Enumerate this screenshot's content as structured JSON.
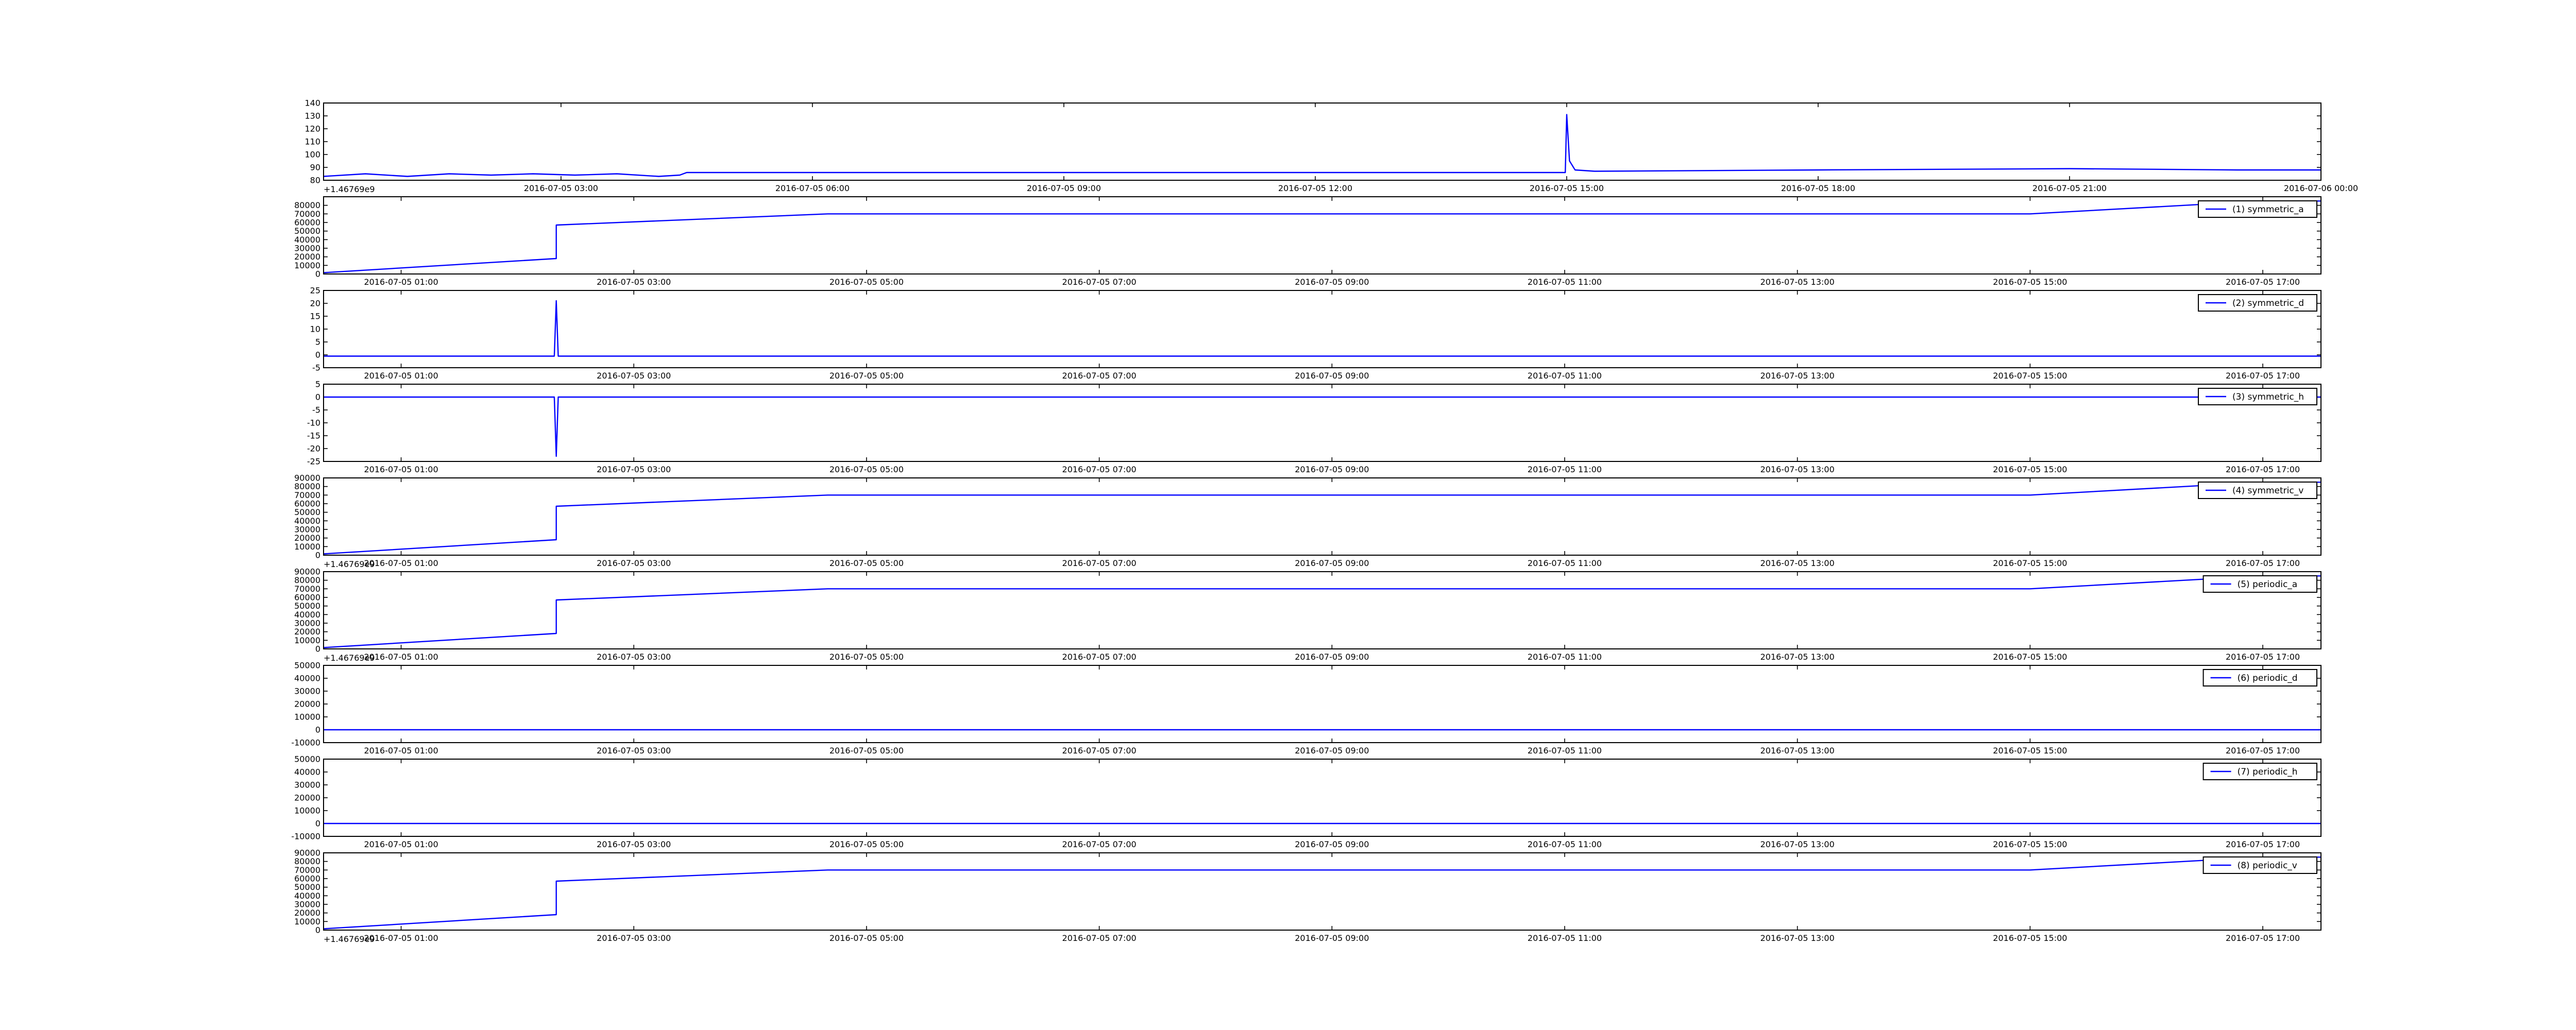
{
  "figure": {
    "line_color": "#0000ff",
    "frame_color": "#000000",
    "background": "#ffffff"
  },
  "chart_data": [
    {
      "type": "line",
      "title": "",
      "xlabel": "",
      "ylabel": "",
      "xlim": [
        "2016-07-05 00:10",
        "2016-07-06 00:00"
      ],
      "ylim": [
        80,
        140
      ],
      "yticks": [
        80,
        90,
        100,
        110,
        120,
        130,
        140
      ],
      "xticks": [
        "2016-07-05 03:00",
        "2016-07-05 06:00",
        "2016-07-05 09:00",
        "2016-07-05 12:00",
        "2016-07-05 15:00",
        "2016-07-05 18:00",
        "2016-07-05 21:00",
        "2016-07-06 00:00"
      ],
      "offset_text": "+1.46769e9",
      "legend": null,
      "grid": false,
      "series": [
        {
          "x": [
            "2016-07-05 00:10",
            "2016-07-05 00:40",
            "2016-07-05 01:10",
            "2016-07-05 01:40",
            "2016-07-05 02:10",
            "2016-07-05 02:40",
            "2016-07-05 03:10",
            "2016-07-05 03:40",
            "2016-07-05 04:10",
            "2016-07-05 04:25",
            "2016-07-05 04:30",
            "2016-07-05 09:00",
            "2016-07-05 14:30",
            "2016-07-05 14:59",
            "2016-07-05 15:00",
            "2016-07-05 15:02",
            "2016-07-05 15:06",
            "2016-07-05 15:20",
            "2016-07-05 18:00",
            "2016-07-05 21:00",
            "2016-07-05 23:00",
            "2016-07-06 00:00"
          ],
          "values": [
            83,
            85,
            83,
            85,
            84,
            85,
            84,
            85,
            83,
            84,
            86,
            86,
            86,
            86,
            131,
            95,
            88,
            87,
            88,
            89,
            88,
            88
          ]
        }
      ]
    },
    {
      "type": "line",
      "title": "",
      "xlabel": "",
      "ylabel": "",
      "xlim": [
        "2016-07-05 00:20",
        "2016-07-05 17:30"
      ],
      "ylim": [
        0,
        90000
      ],
      "yticks": [
        0,
        10000,
        20000,
        30000,
        40000,
        50000,
        60000,
        70000,
        80000
      ],
      "xticks": [
        "2016-07-05 01:00",
        "2016-07-05 03:00",
        "2016-07-05 05:00",
        "2016-07-05 07:00",
        "2016-07-05 09:00",
        "2016-07-05 11:00",
        "2016-07-05 13:00",
        "2016-07-05 15:00",
        "2016-07-05 17:00"
      ],
      "offset_text": "",
      "legend": "top-right",
      "grid": false,
      "series": [
        {
          "name": "(1) symmetric_a",
          "x": [
            "2016-07-05 00:20",
            "2016-07-05 02:20",
            "2016-07-05 02:20",
            "2016-07-05 04:40",
            "2016-07-05 15:00",
            "2016-07-05 17:00",
            "2016-07-05 17:30"
          ],
          "values": [
            1500,
            18000,
            57000,
            70000,
            70000,
            85000,
            85000
          ]
        }
      ]
    },
    {
      "type": "line",
      "title": "",
      "xlabel": "",
      "ylabel": "",
      "xlim": [
        "2016-07-05 00:20",
        "2016-07-05 17:30"
      ],
      "ylim": [
        -5,
        25
      ],
      "yticks": [
        -5,
        0,
        5,
        10,
        15,
        20,
        25
      ],
      "xticks": [
        "2016-07-05 01:00",
        "2016-07-05 03:00",
        "2016-07-05 05:00",
        "2016-07-05 07:00",
        "2016-07-05 09:00",
        "2016-07-05 11:00",
        "2016-07-05 13:00",
        "2016-07-05 15:00",
        "2016-07-05 17:00"
      ],
      "offset_text": "",
      "legend": "top-right",
      "grid": false,
      "series": [
        {
          "name": "(2) symmetric_d",
          "x": [
            "2016-07-05 00:20",
            "2016-07-05 02:19",
            "2016-07-05 02:20",
            "2016-07-05 02:21",
            "2016-07-05 17:30"
          ],
          "values": [
            -0.5,
            -0.5,
            21,
            -0.5,
            -0.5
          ]
        }
      ]
    },
    {
      "type": "line",
      "title": "",
      "xlabel": "",
      "ylabel": "",
      "xlim": [
        "2016-07-05 00:20",
        "2016-07-05 17:30"
      ],
      "ylim": [
        -25,
        5
      ],
      "yticks": [
        -25,
        -20,
        -15,
        -10,
        -5,
        0,
        5
      ],
      "xticks": [
        "2016-07-05 01:00",
        "2016-07-05 03:00",
        "2016-07-05 05:00",
        "2016-07-05 07:00",
        "2016-07-05 09:00",
        "2016-07-05 11:00",
        "2016-07-05 13:00",
        "2016-07-05 15:00",
        "2016-07-05 17:00"
      ],
      "offset_text": "",
      "legend": "top-right",
      "grid": false,
      "series": [
        {
          "name": "(3) symmetric_h",
          "x": [
            "2016-07-05 00:20",
            "2016-07-05 02:19",
            "2016-07-05 02:20",
            "2016-07-05 02:21",
            "2016-07-05 17:30"
          ],
          "values": [
            0,
            0,
            -23,
            0,
            0
          ]
        }
      ]
    },
    {
      "type": "line",
      "title": "",
      "xlabel": "",
      "ylabel": "",
      "xlim": [
        "2016-07-05 00:20",
        "2016-07-05 17:30"
      ],
      "ylim": [
        0,
        90000
      ],
      "yticks": [
        0,
        10000,
        20000,
        30000,
        40000,
        50000,
        60000,
        70000,
        80000,
        90000
      ],
      "xticks": [
        "2016-07-05 01:00",
        "2016-07-05 03:00",
        "2016-07-05 05:00",
        "2016-07-05 07:00",
        "2016-07-05 09:00",
        "2016-07-05 11:00",
        "2016-07-05 13:00",
        "2016-07-05 15:00",
        "2016-07-05 17:00"
      ],
      "offset_text": "+1.46769e9",
      "legend": "top-right",
      "grid": false,
      "series": [
        {
          "name": "(4) symmetric_v",
          "x": [
            "2016-07-05 00:20",
            "2016-07-05 02:20",
            "2016-07-05 02:20",
            "2016-07-05 04:40",
            "2016-07-05 15:00",
            "2016-07-05 17:00",
            "2016-07-05 17:30"
          ],
          "values": [
            1500,
            18000,
            57000,
            70000,
            70000,
            85000,
            85000
          ]
        }
      ]
    },
    {
      "type": "line",
      "title": "",
      "xlabel": "",
      "ylabel": "",
      "xlim": [
        "2016-07-05 00:20",
        "2016-07-05 17:30"
      ],
      "ylim": [
        0,
        90000
      ],
      "yticks": [
        0,
        10000,
        20000,
        30000,
        40000,
        50000,
        60000,
        70000,
        80000,
        90000
      ],
      "xticks": [
        "2016-07-05 01:00",
        "2016-07-05 03:00",
        "2016-07-05 05:00",
        "2016-07-05 07:00",
        "2016-07-05 09:00",
        "2016-07-05 11:00",
        "2016-07-05 13:00",
        "2016-07-05 15:00",
        "2016-07-05 17:00"
      ],
      "offset_text": "+1.46769e9",
      "legend": "top-right",
      "grid": false,
      "series": [
        {
          "name": "(5) periodic_a",
          "x": [
            "2016-07-05 00:20",
            "2016-07-05 02:20",
            "2016-07-05 02:20",
            "2016-07-05 04:40",
            "2016-07-05 15:00",
            "2016-07-05 17:00",
            "2016-07-05 17:30"
          ],
          "values": [
            1500,
            18000,
            57000,
            70000,
            70000,
            85000,
            85000
          ]
        }
      ]
    },
    {
      "type": "line",
      "title": "",
      "xlabel": "",
      "ylabel": "",
      "xlim": [
        "2016-07-05 00:20",
        "2016-07-05 17:30"
      ],
      "ylim": [
        -10000,
        50000
      ],
      "yticks": [
        -10000,
        0,
        10000,
        20000,
        30000,
        40000,
        50000
      ],
      "xticks": [
        "2016-07-05 01:00",
        "2016-07-05 03:00",
        "2016-07-05 05:00",
        "2016-07-05 07:00",
        "2016-07-05 09:00",
        "2016-07-05 11:00",
        "2016-07-05 13:00",
        "2016-07-05 15:00",
        "2016-07-05 17:00"
      ],
      "offset_text": "",
      "legend": "top-right",
      "grid": false,
      "series": [
        {
          "name": "(6) periodic_d",
          "x": [
            "2016-07-05 00:20",
            "2016-07-05 17:30"
          ],
          "values": [
            0,
            0
          ]
        }
      ]
    },
    {
      "type": "line",
      "title": "",
      "xlabel": "",
      "ylabel": "",
      "xlim": [
        "2016-07-05 00:20",
        "2016-07-05 17:30"
      ],
      "ylim": [
        -10000,
        50000
      ],
      "yticks": [
        -10000,
        0,
        10000,
        20000,
        30000,
        40000,
        50000
      ],
      "xticks": [
        "2016-07-05 01:00",
        "2016-07-05 03:00",
        "2016-07-05 05:00",
        "2016-07-05 07:00",
        "2016-07-05 09:00",
        "2016-07-05 11:00",
        "2016-07-05 13:00",
        "2016-07-05 15:00",
        "2016-07-05 17:00"
      ],
      "offset_text": "",
      "legend": "top-right",
      "grid": false,
      "series": [
        {
          "name": "(7) periodic_h",
          "x": [
            "2016-07-05 00:20",
            "2016-07-05 17:30"
          ],
          "values": [
            0,
            0
          ]
        }
      ]
    },
    {
      "type": "line",
      "title": "",
      "xlabel": "",
      "ylabel": "",
      "xlim": [
        "2016-07-05 00:20",
        "2016-07-05 17:30"
      ],
      "ylim": [
        0,
        90000
      ],
      "yticks": [
        0,
        10000,
        20000,
        30000,
        40000,
        50000,
        60000,
        70000,
        80000,
        90000
      ],
      "xticks": [
        "2016-07-05 01:00",
        "2016-07-05 03:00",
        "2016-07-05 05:00",
        "2016-07-05 07:00",
        "2016-07-05 09:00",
        "2016-07-05 11:00",
        "2016-07-05 13:00",
        "2016-07-05 15:00",
        "2016-07-05 17:00"
      ],
      "offset_text": "+1.46769e9",
      "legend": "top-right",
      "grid": false,
      "series": [
        {
          "name": "(8) periodic_v",
          "x": [
            "2016-07-05 00:20",
            "2016-07-05 02:20",
            "2016-07-05 02:20",
            "2016-07-05 04:40",
            "2016-07-05 15:00",
            "2016-07-05 17:00",
            "2016-07-05 17:30"
          ],
          "values": [
            1500,
            18000,
            57000,
            70000,
            70000,
            85000,
            85000
          ]
        }
      ]
    }
  ]
}
